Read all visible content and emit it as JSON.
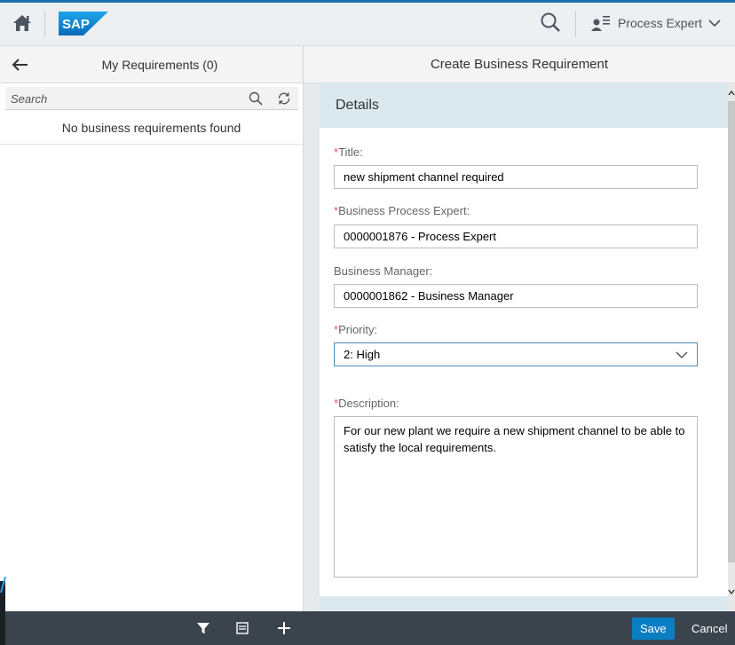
{
  "header": {
    "logo": "SAP",
    "user_label": "Process Expert"
  },
  "master": {
    "title": "My Requirements (0)",
    "search_placeholder": "Search",
    "no_data": "No business requirements found"
  },
  "detail": {
    "title": "Create Business Requirement",
    "section_title": "Details",
    "required_marker": "*",
    "fields": {
      "title_label": "Title:",
      "title_value": "new shipment channel required",
      "expert_label": "Business Process Expert:",
      "expert_value": "0000001876 - Process Expert",
      "manager_label": "Business Manager:",
      "manager_value": "0000001862 - Business Manager",
      "priority_label": "Priority:",
      "priority_value": "2: High",
      "description_label": "Description:",
      "description_value": "For our new plant we require a new shipment channel to be able to satisfy the local requirements."
    }
  },
  "footer": {
    "save_label": "Save",
    "cancel_label": "Cancel",
    "icons": [
      "filter-icon",
      "group-icon",
      "add-icon"
    ]
  },
  "colors": {
    "accent": "#0a7ec2",
    "shell_bg": "#edeff0",
    "footer_bg": "#3b444d",
    "section_bg": "#dbe9ef",
    "required": "#e55555"
  }
}
